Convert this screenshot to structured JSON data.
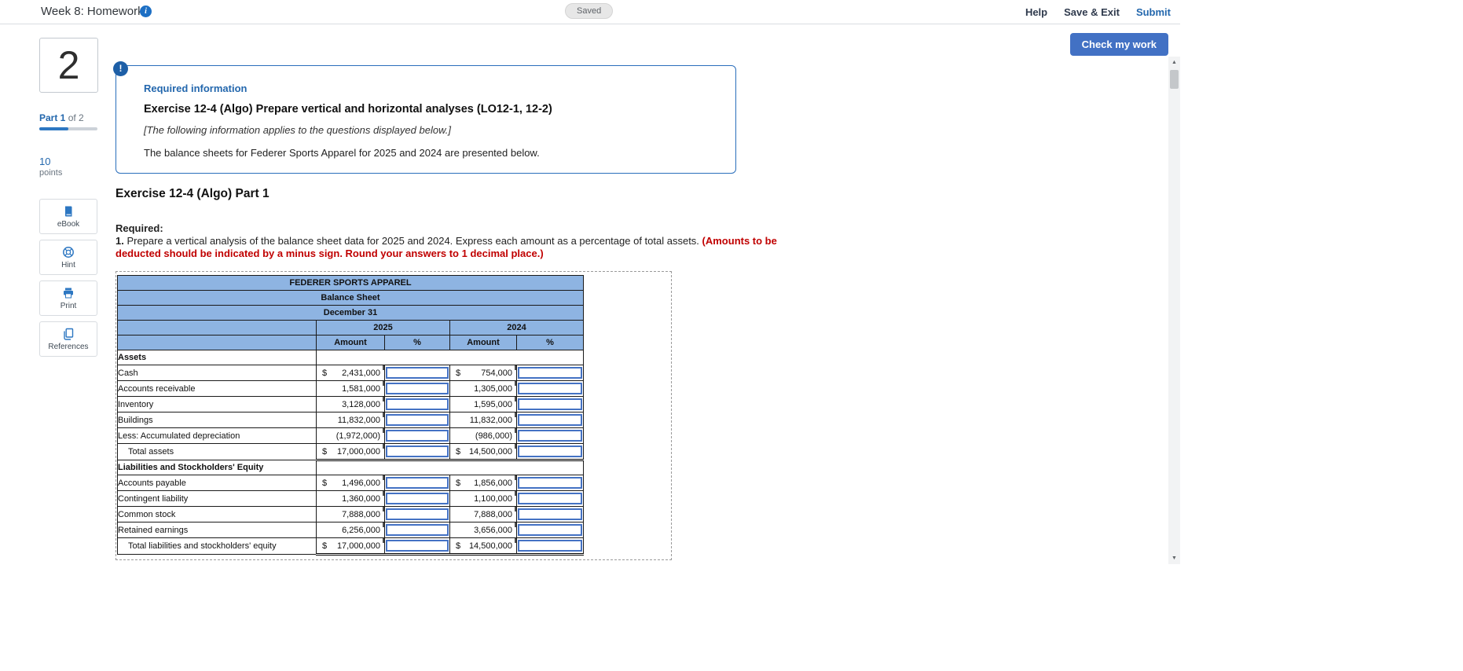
{
  "topbar": {
    "title": "Week 8: Homework",
    "saved": "Saved",
    "help": "Help",
    "save_exit": "Save & Exit",
    "submit": "Submit"
  },
  "sidebar": {
    "question_number": "2",
    "part_bold": "Part 1",
    "part_rest": " of 2",
    "progress_percent": 50,
    "points_value": "10",
    "points_label": "points",
    "tools": [
      {
        "label": "eBook",
        "icon": "ebook-icon"
      },
      {
        "label": "Hint",
        "icon": "hint-icon"
      },
      {
        "label": "Print",
        "icon": "print-icon"
      },
      {
        "label": "References",
        "icon": "references-icon"
      }
    ]
  },
  "main": {
    "check_my_work": "Check my work",
    "info_badge": "!",
    "required_information": "Required information",
    "exercise_title": "Exercise 12-4 (Algo) Prepare vertical and horizontal analyses (LO12-1, 12-2)",
    "applies_note": "[The following information applies to the questions displayed below.]",
    "intro_text": "The balance sheets for Federer Sports Apparel for 2025 and 2024 are presented below.",
    "part_heading": "Exercise 12-4 (Algo) Part 1",
    "required_label": "Required:",
    "instruction_number": "1.",
    "instruction_text": " Prepare a vertical analysis of the balance sheet data for 2025 and 2024. Express each amount as a percentage of total assets. ",
    "instruction_emphasis": "(Amounts to be deducted should be indicated by a minus sign. Round your answers to 1 decimal place.)"
  },
  "table": {
    "company": "FEDERER SPORTS APPAREL",
    "statement": "Balance Sheet",
    "date": "December 31",
    "year_left": "2025",
    "year_right": "2024",
    "amount_header": "Amount",
    "percent_header": "%",
    "rows": [
      {
        "type": "section",
        "label": "Assets"
      },
      {
        "type": "data",
        "label": "Cash",
        "currency_2025": "$",
        "amount_2025": "2,431,000",
        "percent_2025": "",
        "currency_2024": "$",
        "amount_2024": "754,000",
        "percent_2024": ""
      },
      {
        "type": "data",
        "label": "Accounts receivable",
        "currency_2025": "",
        "amount_2025": "1,581,000",
        "percent_2025": "",
        "currency_2024": "",
        "amount_2024": "1,305,000",
        "percent_2024": ""
      },
      {
        "type": "data",
        "label": "Inventory",
        "currency_2025": "",
        "amount_2025": "3,128,000",
        "percent_2025": "",
        "currency_2024": "",
        "amount_2024": "1,595,000",
        "percent_2024": ""
      },
      {
        "type": "data",
        "label": "Buildings",
        "currency_2025": "",
        "amount_2025": "11,832,000",
        "percent_2025": "",
        "currency_2024": "",
        "amount_2024": "11,832,000",
        "percent_2024": ""
      },
      {
        "type": "data",
        "label": "Less: Accumulated depreciation",
        "currency_2025": "",
        "amount_2025": "(1,972,000)",
        "percent_2025": "",
        "currency_2024": "",
        "amount_2024": "(986,000)",
        "percent_2024": ""
      },
      {
        "type": "total",
        "label": "Total assets",
        "currency_2025": "$",
        "amount_2025": "17,000,000",
        "percent_2025": "",
        "currency_2024": "$",
        "amount_2024": "14,500,000",
        "percent_2024": ""
      },
      {
        "type": "section",
        "label": "Liabilities and Stockholders' Equity"
      },
      {
        "type": "data",
        "label": "Accounts payable",
        "currency_2025": "$",
        "amount_2025": "1,496,000",
        "percent_2025": "",
        "currency_2024": "$",
        "amount_2024": "1,856,000",
        "percent_2024": ""
      },
      {
        "type": "data",
        "label": "Contingent liability",
        "currency_2025": "",
        "amount_2025": "1,360,000",
        "percent_2025": "",
        "currency_2024": "",
        "amount_2024": "1,100,000",
        "percent_2024": ""
      },
      {
        "type": "data",
        "label": "Common stock",
        "currency_2025": "",
        "amount_2025": "7,888,000",
        "percent_2025": "",
        "currency_2024": "",
        "amount_2024": "7,888,000",
        "percent_2024": ""
      },
      {
        "type": "data",
        "label": "Retained earnings",
        "currency_2025": "",
        "amount_2025": "6,256,000",
        "percent_2025": "",
        "currency_2024": "",
        "amount_2024": "3,656,000",
        "percent_2024": ""
      },
      {
        "type": "total",
        "label": "Total liabilities and stockholders' equity",
        "currency_2025": "$",
        "amount_2025": "17,000,000",
        "percent_2025": "",
        "currency_2024": "$",
        "amount_2024": "14,500,000",
        "percent_2024": ""
      }
    ]
  },
  "icons": {
    "info": "i",
    "alert": "!",
    "scroll_up": "▲",
    "scroll_down": "▼"
  },
  "colors": {
    "accent_blue": "#2a6ebb",
    "link_blue": "#2367ad",
    "button_blue": "#4271c4",
    "table_header_blue": "#8eb4e2",
    "input_border_blue": "#4472c4",
    "warning_red": "#c00000"
  }
}
